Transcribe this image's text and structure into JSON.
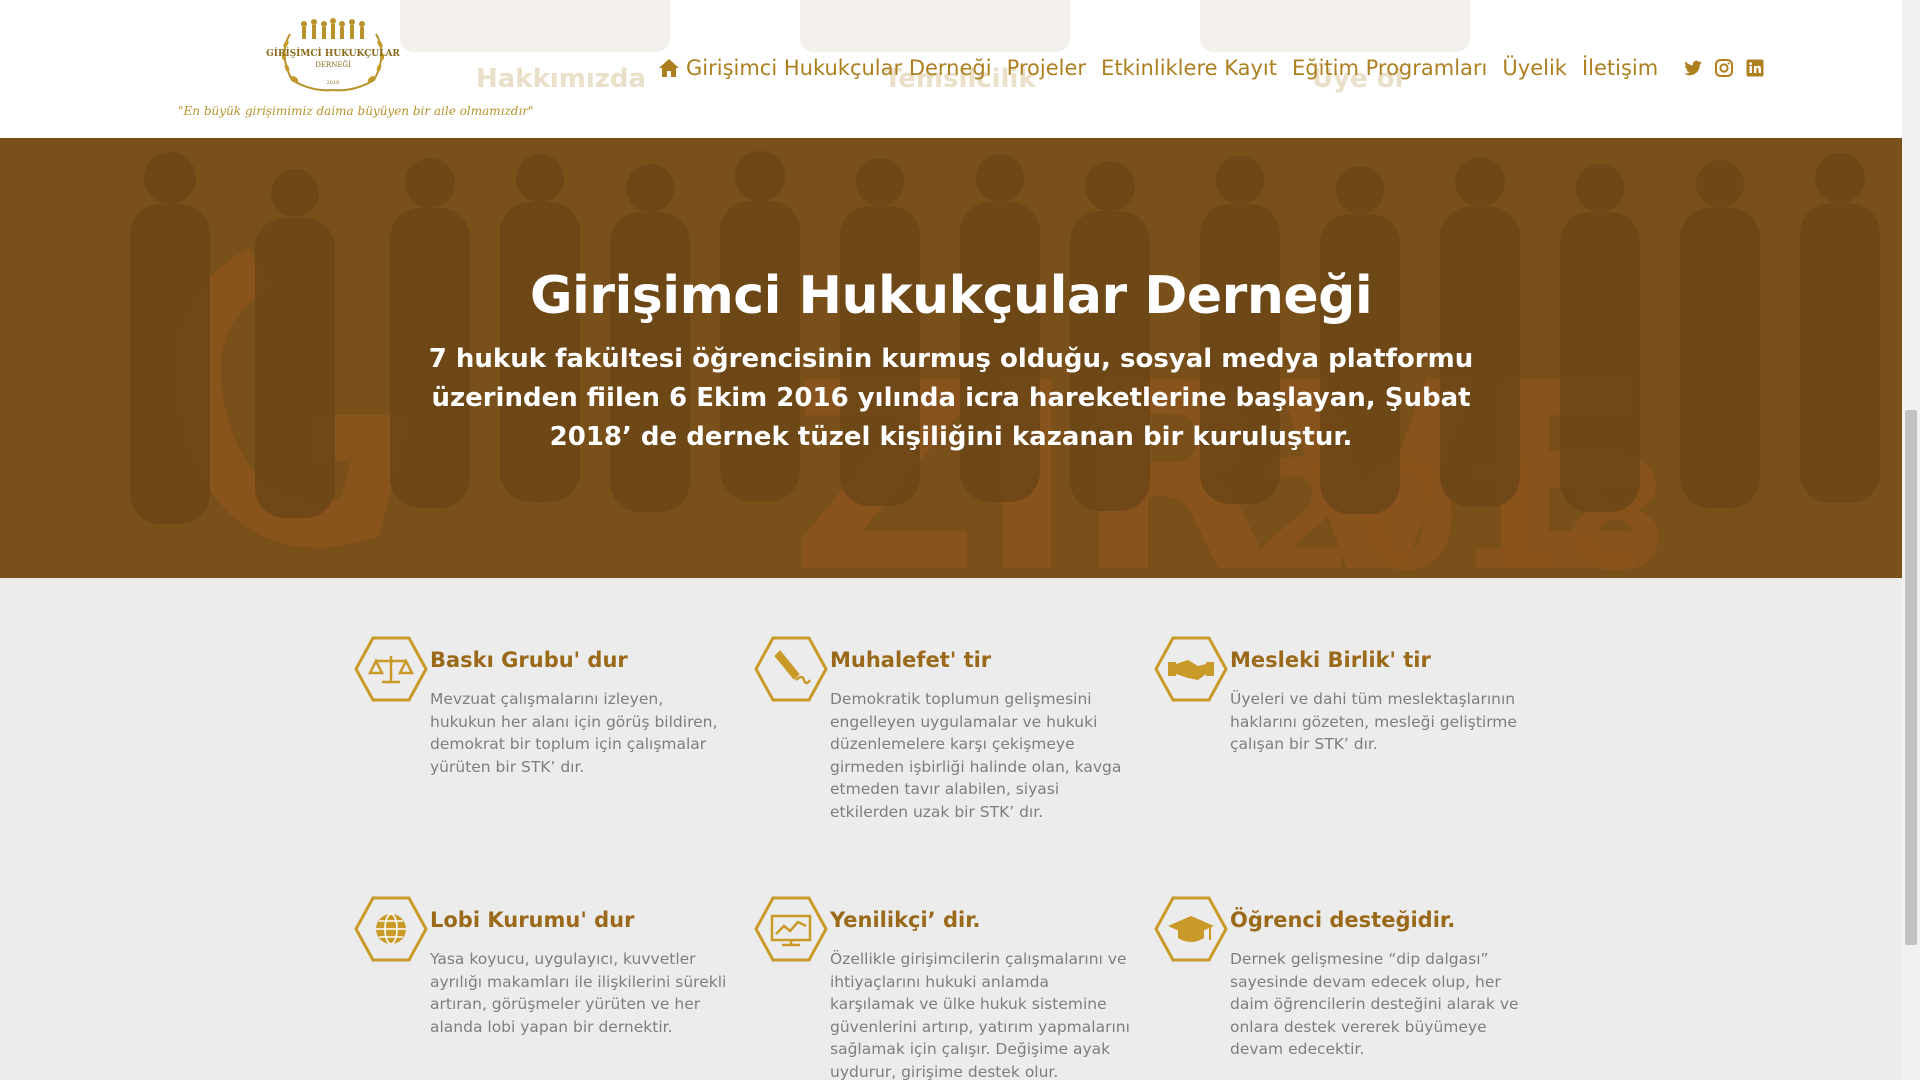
{
  "header": {
    "logo_text": "GİRİŞİMCİ HUKUKÇULAR DERNEĞİ",
    "logo_year": "2018",
    "tagline": "\"En büyük girişimimiz daima büyüyen bir aile olmamızdır\"",
    "ghost_labels": [
      "Hakkımızda",
      "Temsilcilik",
      "Üye ol"
    ],
    "nav": [
      {
        "label": "Girişimci Hukukçular Derneği",
        "icon": "home-icon"
      },
      {
        "label": "Projeler"
      },
      {
        "label": "Etkinliklere Kayıt"
      },
      {
        "label": "Eğitim Programları"
      },
      {
        "label": "Üyelik"
      },
      {
        "label": "İletişim"
      }
    ],
    "social": [
      "twitter-icon",
      "instagram-icon",
      "linkedin-icon"
    ]
  },
  "hero": {
    "title": "Girişimci Hukukçular Derneği",
    "subtitle": "7 hukuk fakültesi öğrencisinin kurmuş olduğu, sosyal medya platformu üzerinden fiilen 6 Ekim 2016 yılında icra hareketlerine başlayan, Şubat 2018’ de dernek tüzel kişiliğini kazanan bir kuruluştur."
  },
  "features": [
    {
      "icon": "scales-icon",
      "title": "Baskı Grubu' dur",
      "text": "Mevzuat çalışmalarını izleyen, hukukun her alanı için görüş bildiren, demokrat bir toplum için çalışmalar yürüten bir STK’ dır."
    },
    {
      "icon": "pen-icon",
      "title": "Muhalefet' tir",
      "text": "Demokratik toplumun gelişmesini engelleyen uygulamalar ve hukuki düzenlemelere karşı çekişmeye girmeden işbirliği halinde olan, kavga etmeden tavır alabilen, siyasi etkilerden uzak bir STK’ dır."
    },
    {
      "icon": "handshake-icon",
      "title": "Mesleki Birlik' tir",
      "text": "Üyeleri ve dahi tüm meslektaşlarının haklarını gözeten, mesleği geliştirme çalışan bir STK’ dır."
    },
    {
      "icon": "globe-icon",
      "title": "Lobi Kurumu' dur",
      "text": "Yasa koyucu, uygulayıcı, kuvvetler ayrılığı makamları ile ilişkilerini sürekli artıran, görüşmeler yürüten ve her alanda lobi yapan bir dernektir."
    },
    {
      "icon": "monitor-chart-icon",
      "title": "Yenilikçi’ dir.",
      "text": "Özellikle girişimcilerin çalışmalarını ve ihtiyaçlarını hukuki anlamda karşılamak ve ülke hukuk sistemine güvenlerini artırıp, yatırım yapmalarını sağlamak için çalışır. Değişime ayak uydurur, girişime destek olur."
    },
    {
      "icon": "graduation-cap-icon",
      "title": "Öğrenci desteğidir.",
      "text": "Dernek gelişmesine “dip dalgası” sayesinde devam edecek olup, her daim öğrencilerin desteğini alarak ve onlara destek vererek büyümeye devam edecektir."
    }
  ],
  "colors": {
    "accent": "#ae7f1f",
    "hero_overlay": "#7e5219",
    "feature_title": "#9a6a1a",
    "icon_gold": "#c99a28"
  }
}
